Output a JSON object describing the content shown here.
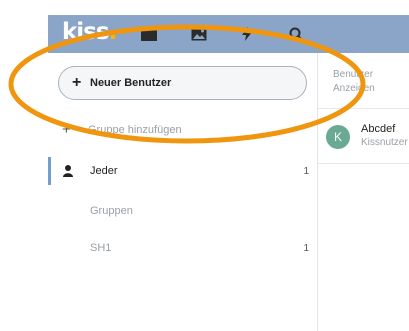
{
  "app": {
    "logo_text": "kiss",
    "logo_dot": "."
  },
  "topbar": {
    "icons": [
      "folder-icon",
      "image-icon",
      "lightning-icon",
      "search-icon"
    ],
    "background_color": "#8aa5c8"
  },
  "sidebar": {
    "new_user_button": {
      "plus": "+",
      "label": "Neuer Benutzer"
    },
    "add_group": {
      "plus": "+",
      "label": "Gruppe hinzufügen"
    },
    "items": [
      {
        "label": "Jeder",
        "count": "1",
        "active": true
      },
      {
        "label": "Gruppen",
        "count": ""
      },
      {
        "label": "SH1",
        "count": "1"
      }
    ]
  },
  "main": {
    "header_line1": "Benutzer",
    "header_line2": "Anzeigen",
    "rows": [
      {
        "avatar": "K",
        "title": "Abcdef",
        "subtitle": "Kissnutzer",
        "avatar_color": "#6aaa94"
      }
    ]
  },
  "annotation": {
    "color": "#f0950e"
  }
}
